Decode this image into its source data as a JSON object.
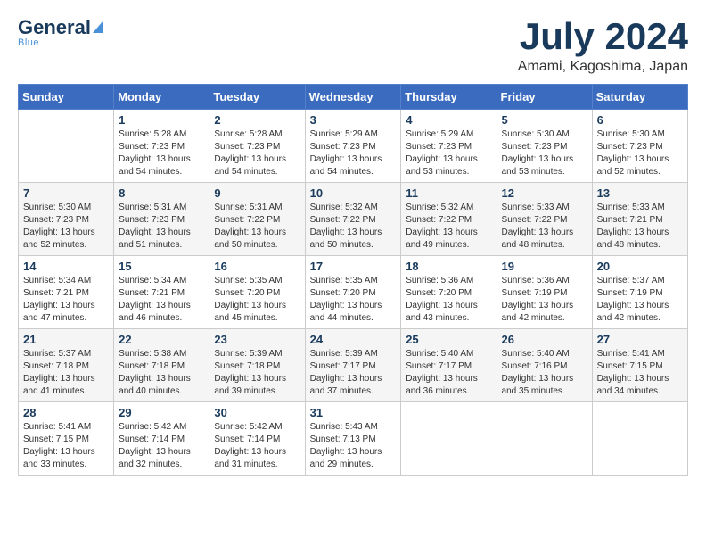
{
  "header": {
    "logo_line1": "General",
    "logo_line2": "Blue",
    "month": "July 2024",
    "location": "Amami, Kagoshima, Japan"
  },
  "weekdays": [
    "Sunday",
    "Monday",
    "Tuesday",
    "Wednesday",
    "Thursday",
    "Friday",
    "Saturday"
  ],
  "weeks": [
    [
      {
        "day": "",
        "sunrise": "",
        "sunset": "",
        "daylight": ""
      },
      {
        "day": "1",
        "sunrise": "5:28 AM",
        "sunset": "7:23 PM",
        "daylight": "13 hours and 54 minutes."
      },
      {
        "day": "2",
        "sunrise": "5:28 AM",
        "sunset": "7:23 PM",
        "daylight": "13 hours and 54 minutes."
      },
      {
        "day": "3",
        "sunrise": "5:29 AM",
        "sunset": "7:23 PM",
        "daylight": "13 hours and 54 minutes."
      },
      {
        "day": "4",
        "sunrise": "5:29 AM",
        "sunset": "7:23 PM",
        "daylight": "13 hours and 53 minutes."
      },
      {
        "day": "5",
        "sunrise": "5:30 AM",
        "sunset": "7:23 PM",
        "daylight": "13 hours and 53 minutes."
      },
      {
        "day": "6",
        "sunrise": "5:30 AM",
        "sunset": "7:23 PM",
        "daylight": "13 hours and 52 minutes."
      }
    ],
    [
      {
        "day": "7",
        "sunrise": "5:30 AM",
        "sunset": "7:23 PM",
        "daylight": "13 hours and 52 minutes."
      },
      {
        "day": "8",
        "sunrise": "5:31 AM",
        "sunset": "7:23 PM",
        "daylight": "13 hours and 51 minutes."
      },
      {
        "day": "9",
        "sunrise": "5:31 AM",
        "sunset": "7:22 PM",
        "daylight": "13 hours and 50 minutes."
      },
      {
        "day": "10",
        "sunrise": "5:32 AM",
        "sunset": "7:22 PM",
        "daylight": "13 hours and 50 minutes."
      },
      {
        "day": "11",
        "sunrise": "5:32 AM",
        "sunset": "7:22 PM",
        "daylight": "13 hours and 49 minutes."
      },
      {
        "day": "12",
        "sunrise": "5:33 AM",
        "sunset": "7:22 PM",
        "daylight": "13 hours and 48 minutes."
      },
      {
        "day": "13",
        "sunrise": "5:33 AM",
        "sunset": "7:21 PM",
        "daylight": "13 hours and 48 minutes."
      }
    ],
    [
      {
        "day": "14",
        "sunrise": "5:34 AM",
        "sunset": "7:21 PM",
        "daylight": "13 hours and 47 minutes."
      },
      {
        "day": "15",
        "sunrise": "5:34 AM",
        "sunset": "7:21 PM",
        "daylight": "13 hours and 46 minutes."
      },
      {
        "day": "16",
        "sunrise": "5:35 AM",
        "sunset": "7:20 PM",
        "daylight": "13 hours and 45 minutes."
      },
      {
        "day": "17",
        "sunrise": "5:35 AM",
        "sunset": "7:20 PM",
        "daylight": "13 hours and 44 minutes."
      },
      {
        "day": "18",
        "sunrise": "5:36 AM",
        "sunset": "7:20 PM",
        "daylight": "13 hours and 43 minutes."
      },
      {
        "day": "19",
        "sunrise": "5:36 AM",
        "sunset": "7:19 PM",
        "daylight": "13 hours and 42 minutes."
      },
      {
        "day": "20",
        "sunrise": "5:37 AM",
        "sunset": "7:19 PM",
        "daylight": "13 hours and 42 minutes."
      }
    ],
    [
      {
        "day": "21",
        "sunrise": "5:37 AM",
        "sunset": "7:18 PM",
        "daylight": "13 hours and 41 minutes."
      },
      {
        "day": "22",
        "sunrise": "5:38 AM",
        "sunset": "7:18 PM",
        "daylight": "13 hours and 40 minutes."
      },
      {
        "day": "23",
        "sunrise": "5:39 AM",
        "sunset": "7:18 PM",
        "daylight": "13 hours and 39 minutes."
      },
      {
        "day": "24",
        "sunrise": "5:39 AM",
        "sunset": "7:17 PM",
        "daylight": "13 hours and 37 minutes."
      },
      {
        "day": "25",
        "sunrise": "5:40 AM",
        "sunset": "7:17 PM",
        "daylight": "13 hours and 36 minutes."
      },
      {
        "day": "26",
        "sunrise": "5:40 AM",
        "sunset": "7:16 PM",
        "daylight": "13 hours and 35 minutes."
      },
      {
        "day": "27",
        "sunrise": "5:41 AM",
        "sunset": "7:15 PM",
        "daylight": "13 hours and 34 minutes."
      }
    ],
    [
      {
        "day": "28",
        "sunrise": "5:41 AM",
        "sunset": "7:15 PM",
        "daylight": "13 hours and 33 minutes."
      },
      {
        "day": "29",
        "sunrise": "5:42 AM",
        "sunset": "7:14 PM",
        "daylight": "13 hours and 32 minutes."
      },
      {
        "day": "30",
        "sunrise": "5:42 AM",
        "sunset": "7:14 PM",
        "daylight": "13 hours and 31 minutes."
      },
      {
        "day": "31",
        "sunrise": "5:43 AM",
        "sunset": "7:13 PM",
        "daylight": "13 hours and 29 minutes."
      },
      {
        "day": "",
        "sunrise": "",
        "sunset": "",
        "daylight": ""
      },
      {
        "day": "",
        "sunrise": "",
        "sunset": "",
        "daylight": ""
      },
      {
        "day": "",
        "sunrise": "",
        "sunset": "",
        "daylight": ""
      }
    ]
  ]
}
